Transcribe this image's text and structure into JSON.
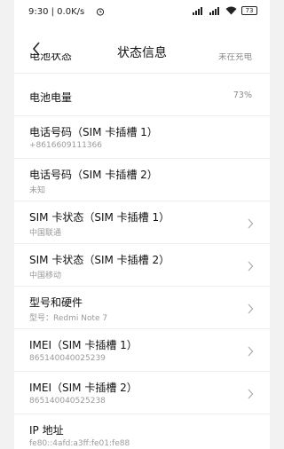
{
  "status_bar": {
    "time_speed": "9:30 | 0.0K/s",
    "battery": "73"
  },
  "nav": {
    "title": "状态信息"
  },
  "rows": [
    {
      "title": "电池状态",
      "value": "未在充电"
    },
    {
      "title": "电池电量",
      "value": "73%"
    },
    {
      "title": "电话号码（SIM 卡插槽 1）",
      "sub": "+8616609111366"
    },
    {
      "title": "电话号码（SIM 卡插槽 2）",
      "sub": "未知"
    },
    {
      "title": "SIM 卡状态（SIM 卡插槽 1）",
      "sub": "中国联通"
    },
    {
      "title": "SIM 卡状态（SIM 卡插槽 2）",
      "sub": "中国移动"
    },
    {
      "title": "型号和硬件",
      "sub": "型号：Redmi Note 7"
    },
    {
      "title": "IMEI（SIM 卡插槽 1）",
      "sub": "865140040025239"
    },
    {
      "title": "IMEI（SIM 卡插槽 2）",
      "sub": "865140040525238"
    },
    {
      "title": "IP 地址",
      "sub": "fe80::4afd:a3ff:fe01:fe88"
    }
  ],
  "icons": {
    "back": "chevron-left-icon",
    "row_chevron": "chevron-right-icon",
    "alarm": "alarm-icon",
    "signal": "signal-icon",
    "wifi": "wifi-icon"
  }
}
